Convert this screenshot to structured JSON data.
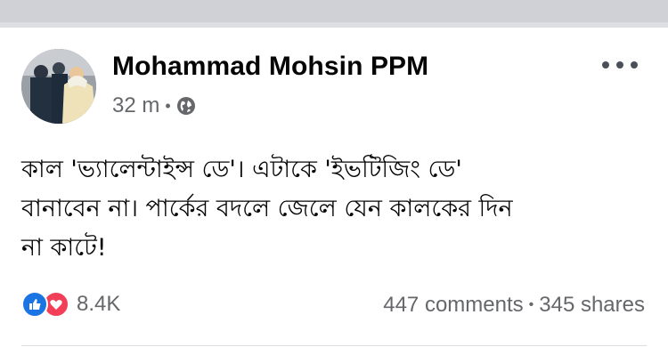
{
  "post": {
    "author": "Mohammad Mohsin PPM",
    "time": "32 m",
    "time_separator": "•",
    "body_lines": [
      "কাল 'ভ্যালেন্টাইন্স ডে'। এটাকে 'ইভটিজিং ডে'",
      "বানাবেন না। পার্কের বদলে জেলে যেন কালকের দিন",
      "না কাটে!"
    ],
    "reactions_count": "8.4K",
    "comments": "447 comments",
    "stats_separator": "•",
    "shares": "345 shares"
  },
  "icons": {
    "privacy": "globe-icon",
    "menu": "more-options-icon",
    "reaction_1": "like-reaction-icon",
    "reaction_2": "love-reaction-icon"
  },
  "colors": {
    "like": "#1b74e4",
    "love": "#f33e58",
    "secondary_text": "#65676b",
    "top_band": "#cfd1d6"
  }
}
